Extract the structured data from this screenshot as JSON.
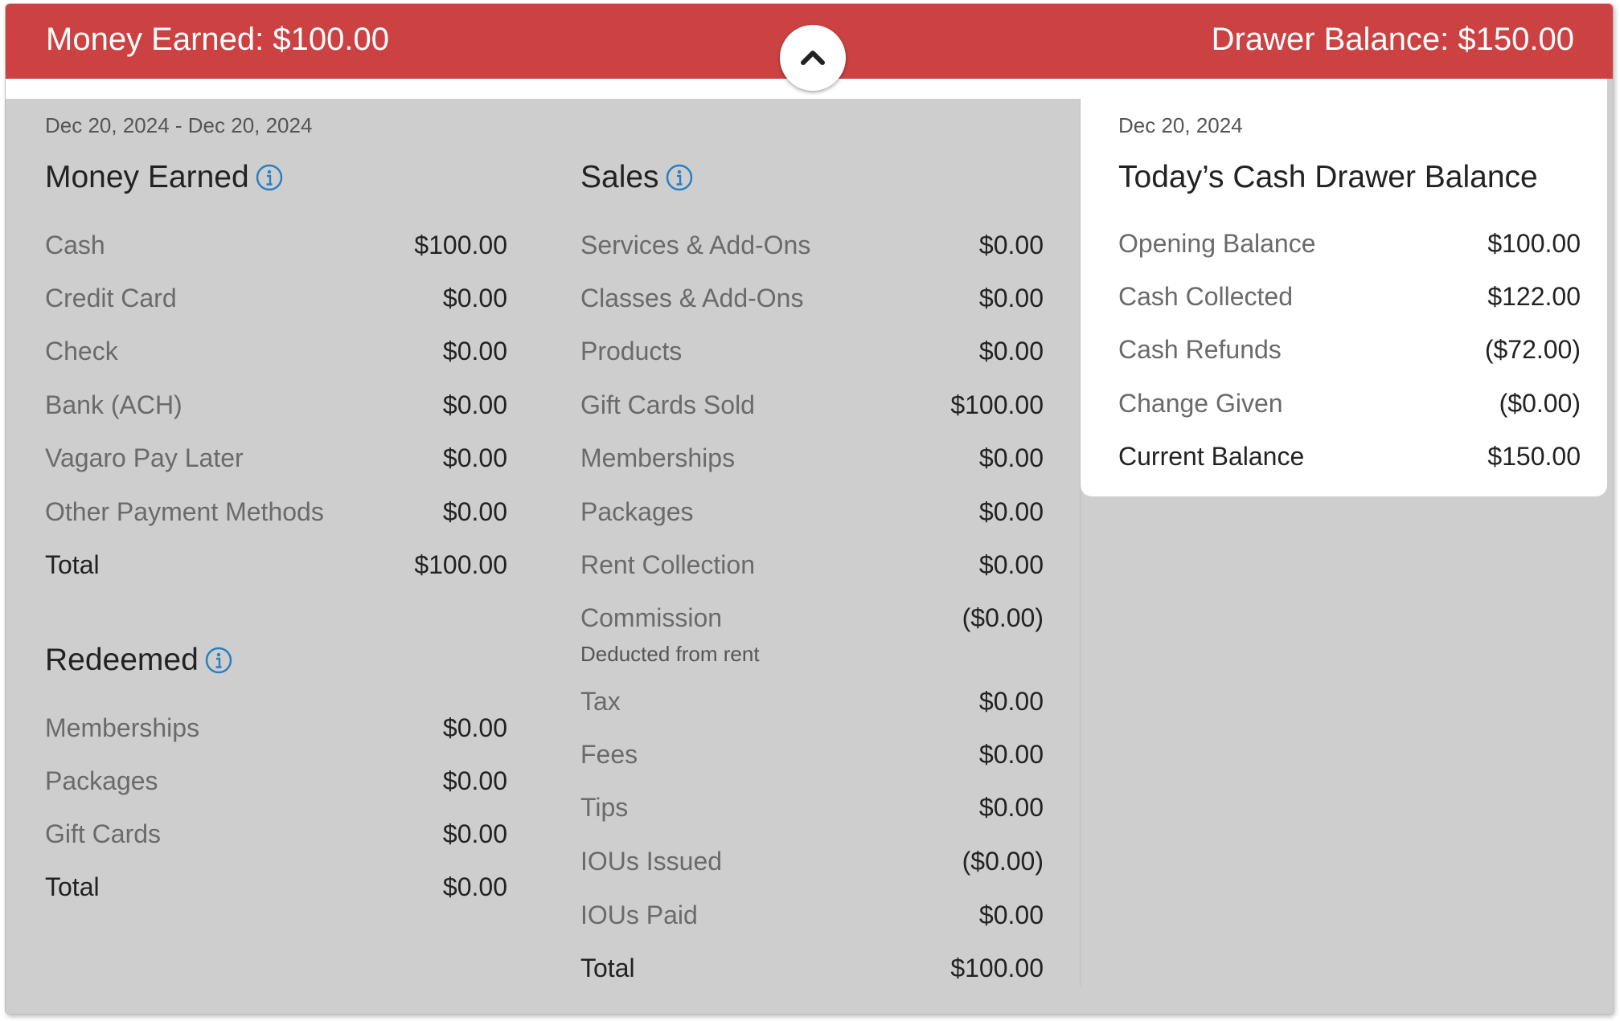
{
  "header": {
    "money_earned": "Money Earned: $100.00",
    "drawer_balance": "Drawer Balance: $150.00"
  },
  "report": {
    "date_range": "Dec 20, 2024 - Dec 20, 2024",
    "money_earned": {
      "title": "Money Earned",
      "rows": [
        {
          "label": "Cash",
          "value": "$100.00"
        },
        {
          "label": "Credit Card",
          "value": "$0.00"
        },
        {
          "label": "Check",
          "value": "$0.00"
        },
        {
          "label": "Bank (ACH)",
          "value": "$0.00"
        },
        {
          "label": "Vagaro Pay Later",
          "value": "$0.00"
        },
        {
          "label": "Other Payment Methods",
          "value": "$0.00"
        },
        {
          "label": "Total",
          "value": "$100.00"
        }
      ]
    },
    "redeemed": {
      "title": "Redeemed",
      "rows": [
        {
          "label": "Memberships",
          "value": "$0.00"
        },
        {
          "label": "Packages",
          "value": "$0.00"
        },
        {
          "label": "Gift Cards",
          "value": "$0.00"
        },
        {
          "label": "Total",
          "value": "$0.00"
        }
      ]
    },
    "sales": {
      "title": "Sales",
      "rows": [
        {
          "label": "Services & Add-Ons",
          "value": "$0.00"
        },
        {
          "label": "Classes & Add-Ons",
          "value": "$0.00"
        },
        {
          "label": "Products",
          "value": "$0.00"
        },
        {
          "label": "Gift Cards Sold",
          "value": "$100.00"
        },
        {
          "label": "Memberships",
          "value": "$0.00"
        },
        {
          "label": "Packages",
          "value": "$0.00"
        },
        {
          "label": "Rent Collection",
          "value": "$0.00"
        },
        {
          "label": "Commission",
          "value": "($0.00)"
        },
        {
          "label": "Tax",
          "value": "$0.00"
        },
        {
          "label": "Fees",
          "value": "$0.00"
        },
        {
          "label": "Tips",
          "value": "$0.00"
        },
        {
          "label": "IOUs Issued",
          "value": "($0.00)"
        },
        {
          "label": "IOUs Paid",
          "value": "$0.00"
        },
        {
          "label": "Total",
          "value": "$100.00"
        }
      ],
      "commission_note": "Deducted from rent"
    }
  },
  "drawer": {
    "date": "Dec 20, 2024",
    "title": "Today’s Cash Drawer Balance",
    "rows": [
      {
        "label": "Opening Balance",
        "value": "$100.00"
      },
      {
        "label": "Cash Collected",
        "value": "$122.00"
      },
      {
        "label": "Cash Refunds",
        "value": "($72.00)"
      },
      {
        "label": "Change Given",
        "value": "($0.00)"
      },
      {
        "label": "Current Balance",
        "value": "$150.00"
      }
    ]
  },
  "icons": {
    "collapse": "chevron-up-icon",
    "info": "info-circle-icon"
  },
  "colors": {
    "header_red": "#cc4243",
    "info_blue": "#2a7fc1",
    "panel_gray": "#cecece"
  }
}
